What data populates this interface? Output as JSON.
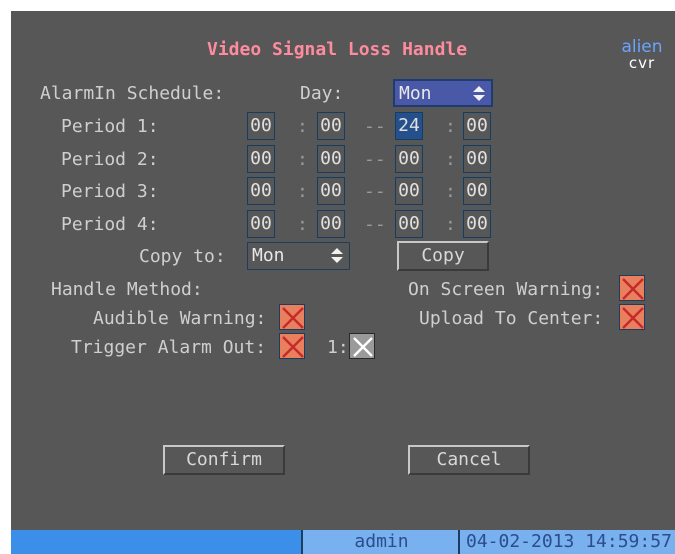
{
  "title": "Video Signal Loss Handle",
  "logo": {
    "line1": "alien",
    "line2": "cvr"
  },
  "schedule": {
    "label": "AlarmIn Schedule:",
    "day_label": "Day:",
    "day_value": "Mon",
    "periods": [
      {
        "label": "Period 1:",
        "start_h": "00",
        "start_m": "00",
        "end_h": "24",
        "end_m": "00"
      },
      {
        "label": "Period 2:",
        "start_h": "00",
        "start_m": "00",
        "end_h": "00",
        "end_m": "00"
      },
      {
        "label": "Period 3:",
        "start_h": "00",
        "start_m": "00",
        "end_h": "00",
        "end_m": "00"
      },
      {
        "label": "Period 4:",
        "start_h": "00",
        "start_m": "00",
        "end_h": "00",
        "end_m": "00"
      }
    ],
    "separator": ":",
    "dash": "--"
  },
  "copy": {
    "label": "Copy to:",
    "value": "Mon",
    "button": "Copy"
  },
  "handle": {
    "label": "Handle Method:",
    "on_screen_warning": "On Screen Warning:",
    "audible_warning": "Audible Warning:",
    "upload_to_center": "Upload To Center:",
    "trigger_alarm_out": "Trigger Alarm Out:",
    "alarm_out_1": "1:"
  },
  "buttons": {
    "confirm": "Confirm",
    "cancel": "Cancel"
  },
  "status": {
    "user": "admin",
    "datetime": "04-02-2013 14:59:57"
  },
  "colors": {
    "background": "#575757",
    "title": "#ff8c9e",
    "status_bar": "#3b8fe8",
    "checkbox": "#e8805e"
  }
}
